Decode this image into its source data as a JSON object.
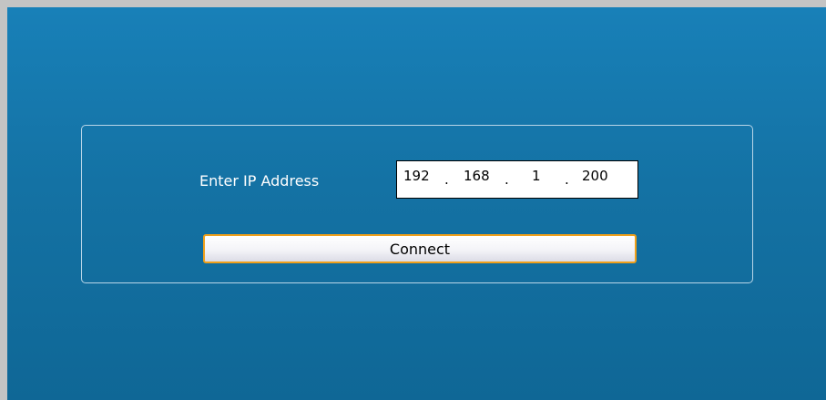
{
  "form": {
    "ip_label": "Enter IP Address",
    "ip_octets": [
      "192",
      "168",
      "1",
      "200"
    ],
    "ip_separator": ".",
    "connect_label": "Connect"
  },
  "colors": {
    "background": "#1478ae",
    "button_focus_border": "#f0a01a",
    "group_border": "#b9d6e8"
  }
}
